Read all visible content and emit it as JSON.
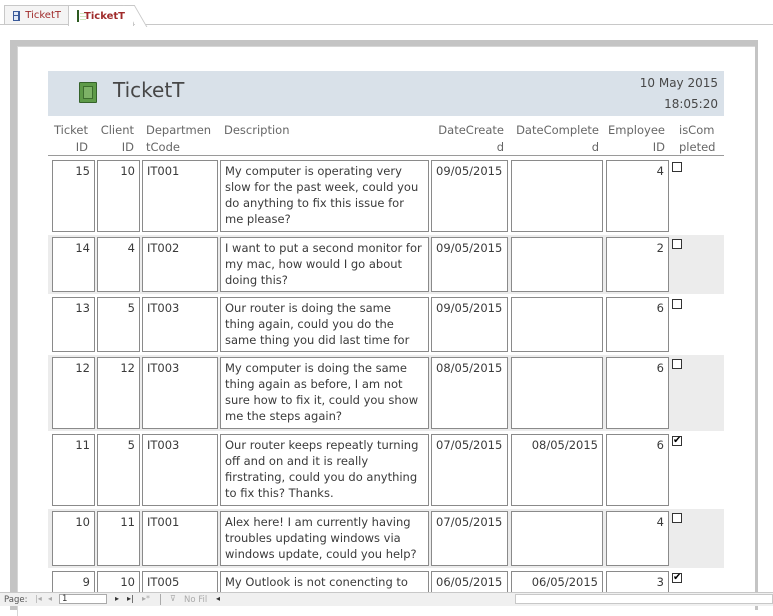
{
  "tabs": [
    {
      "label": "TicketT",
      "icon": "table-icon"
    },
    {
      "label": "TicketT",
      "icon": "report-icon"
    }
  ],
  "report": {
    "title": "TicketT",
    "date": "10 May 2015",
    "time": "18:05:20"
  },
  "columns": {
    "ticket_id": [
      "Ticket",
      "ID"
    ],
    "client_id": [
      "Client",
      "ID"
    ],
    "department": [
      "Departmen",
      "tCode"
    ],
    "description": [
      "Description"
    ],
    "date_created": [
      "DateCreate",
      "d"
    ],
    "date_completed": [
      "DateComplete",
      "d"
    ],
    "employee_id": [
      "Employee",
      "ID"
    ],
    "is_completed": [
      "isCom",
      "pleted"
    ]
  },
  "rows": [
    {
      "ticket_id": "15",
      "client_id": "10",
      "dept": "IT001",
      "description": "My computer is operating very slow for the past week, could you do anything to fix this issue for me please?",
      "created": "09/05/2015",
      "completed": "",
      "employee": "4",
      "is_completed": false
    },
    {
      "ticket_id": "14",
      "client_id": "4",
      "dept": "IT002",
      "description": "I want to put a second monitor for my mac, how would I go about doing this?",
      "created": "09/05/2015",
      "completed": "",
      "employee": "2",
      "is_completed": false
    },
    {
      "ticket_id": "13",
      "client_id": "5",
      "dept": "IT003",
      "description": "Our router is doing the same thing again, could you do the same thing you did last time for me please?",
      "created": "09/05/2015",
      "completed": "",
      "employee": "6",
      "is_completed": false
    },
    {
      "ticket_id": "12",
      "client_id": "12",
      "dept": "IT003",
      "description": "My computer is doing the same thing again as before, I am not sure how to fix it, could you show me the steps again?",
      "created": "08/05/2015",
      "completed": "",
      "employee": "6",
      "is_completed": false
    },
    {
      "ticket_id": "11",
      "client_id": "5",
      "dept": "IT003",
      "description": "Our router keeps repeatly turning off and on and it is really firstrating, could you do anything to fix this? Thanks.",
      "created": "07/05/2015",
      "completed": "08/05/2015",
      "employee": "6",
      "is_completed": true
    },
    {
      "ticket_id": "10",
      "client_id": "11",
      "dept": "IT001",
      "description": "Alex here! I am currently having troubles updating windows via windows update, could you help?",
      "created": "07/05/2015",
      "completed": "",
      "employee": "4",
      "is_completed": false
    },
    {
      "ticket_id": "9",
      "client_id": "10",
      "dept": "IT005",
      "description": "My Outlook is not conencting to our",
      "created": "06/05/2015",
      "completed": "06/05/2015",
      "employee": "3",
      "is_completed": true
    }
  ],
  "statusbar": {
    "page_label": "Page:",
    "page_value": "1",
    "filter_label": "No Fil"
  }
}
